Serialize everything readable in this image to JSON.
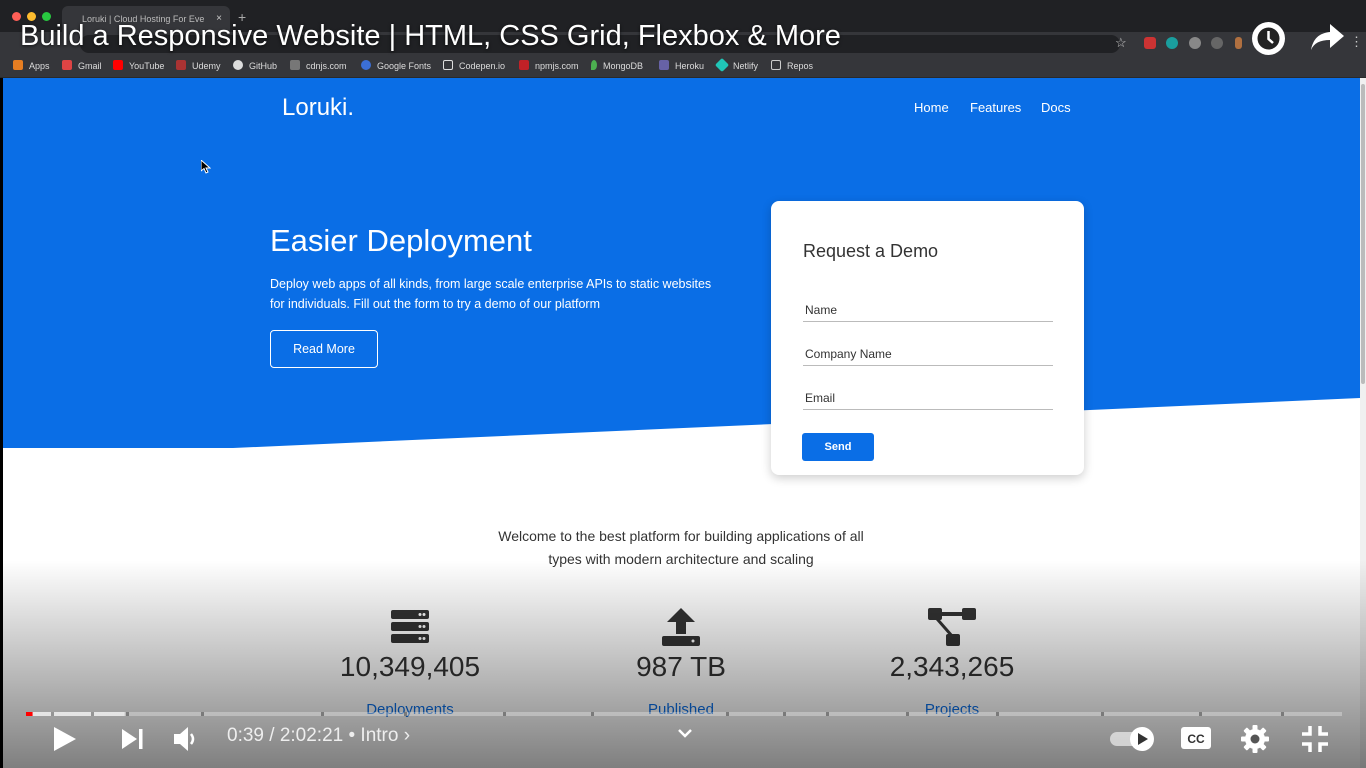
{
  "browser": {
    "tab_title": "Loruki | Cloud Hosting For Eve",
    "tab_close": "×",
    "new_tab": "+",
    "bookmarks": [
      "Apps",
      "Gmail",
      "YouTube",
      "Udemy",
      "GitHub",
      "cdnjs.com",
      "Google Fonts",
      "Codepen.io",
      "npmjs.com",
      "MongoDB",
      "Heroku",
      "Netlify",
      "Repos"
    ]
  },
  "video": {
    "title": "Build a Responsive Website | HTML, CSS Grid, Flexbox & More",
    "time": "0:39 / 2:02:21 • Intro ›",
    "progress_percent": 0.5,
    "buffered_percent": 7.5
  },
  "site": {
    "logo": "Loruki.",
    "nav": [
      "Home",
      "Features",
      "Docs"
    ],
    "hero": {
      "title": "Easier Deployment",
      "text": "Deploy web apps of all kinds, from large scale enterprise APIs to static websites for individuals. Fill out the form to try a demo of our platform",
      "button": "Read More"
    },
    "form": {
      "title": "Request a Demo",
      "fields": [
        "Name",
        "Company Name",
        "Email"
      ],
      "submit": "Send"
    },
    "welcome": "Welcome to the best platform for building applications of all types with modern architecture and scaling",
    "stats": [
      {
        "value": "10,349,405",
        "label": "Deployments",
        "icon": "server-icon"
      },
      {
        "value": "987 TB",
        "label": "Published",
        "icon": "upload-icon"
      },
      {
        "value": "2,343,265",
        "label": "Projects",
        "icon": "project-diagram-icon"
      }
    ]
  },
  "colors": {
    "primary": "#0a6ee6",
    "chrome_dark": "#202124",
    "chrome_mid": "#35363a",
    "progress_red": "#f00"
  }
}
